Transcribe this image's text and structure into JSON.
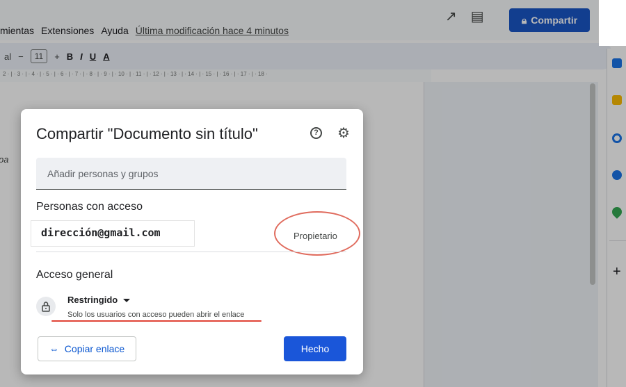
{
  "menubar": {
    "menus": [
      "mientas",
      "Extensiones",
      "Ayuda"
    ],
    "last_modified": "Última modificación hace 4 minutos",
    "share_label": "Compartir",
    "icons": [
      "trend-icon",
      "comment-icon",
      "lock-icon"
    ]
  },
  "toolbar": {
    "font_name": "al",
    "font_size": "11",
    "minus": "−",
    "plus": "+",
    "bold": "B",
    "italic": "I",
    "underline": "U",
    "text_color": "A"
  },
  "ruler": {
    "text": "2 · | · 3 · | · 4 · | · 5 · | · 6 · | · 7 · | · 8 · | · 9 · | · 10 · | · 11 · | · 12 · | · 13 · | · 14 · | · 15 · | · 16 · | · 17 · | · 18 ·"
  },
  "document": {
    "left_fragment": "pa"
  },
  "dialog": {
    "title": "Compartir \"Documento sin título\"",
    "add_placeholder": "Añadir personas y grupos",
    "people_heading": "Personas con acceso",
    "person_email": "dirección@gmail.com",
    "person_role": "Propietario",
    "general_heading": "Acceso general",
    "access_level": "Restringido",
    "access_description": "Solo los usuarios con acceso pueden abrir el enlace",
    "copy_link_label": "Copiar enlace",
    "done_label": "Hecho",
    "help_glyph": "?",
    "gear_glyph": "⚙"
  },
  "colors": {
    "primary": "#1a56d9",
    "annotation_red": "#e04337"
  }
}
